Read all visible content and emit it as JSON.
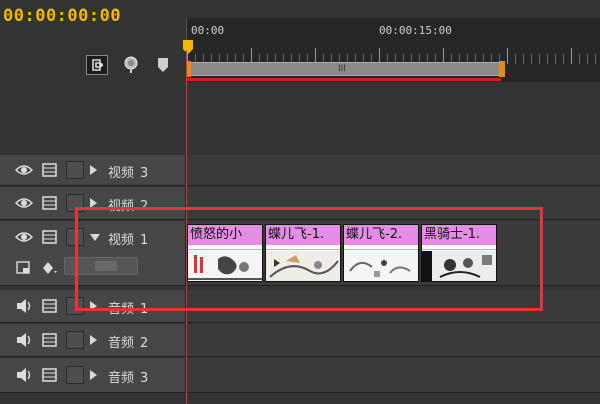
{
  "timecode": "00:00:00:00",
  "ruler": {
    "start_label": "00:00",
    "mid_label": "00:00:15:00",
    "workarea_grip": "III"
  },
  "tracks": [
    {
      "kind": "video",
      "name": "视频",
      "number": "3",
      "expanded": false
    },
    {
      "kind": "video",
      "name": "视频",
      "number": "2",
      "expanded": false
    },
    {
      "kind": "video",
      "name": "视频",
      "number": "1",
      "expanded": true
    },
    {
      "kind": "audio",
      "name": "音频",
      "number": "1",
      "expanded": false
    },
    {
      "kind": "audio",
      "name": "音频",
      "number": "2",
      "expanded": false
    },
    {
      "kind": "audio",
      "name": "音频",
      "number": "3",
      "expanded": false
    }
  ],
  "clips": [
    {
      "title": "愤怒的小"
    },
    {
      "title": "蝶儿飞-1."
    },
    {
      "title": "蝶儿飞-2."
    },
    {
      "title": "黑骑士-1."
    }
  ],
  "colors": {
    "accent": "#f5b800",
    "clip_header": "#e58de5",
    "highlight": "#e5343b",
    "playhead": "#d33333"
  }
}
